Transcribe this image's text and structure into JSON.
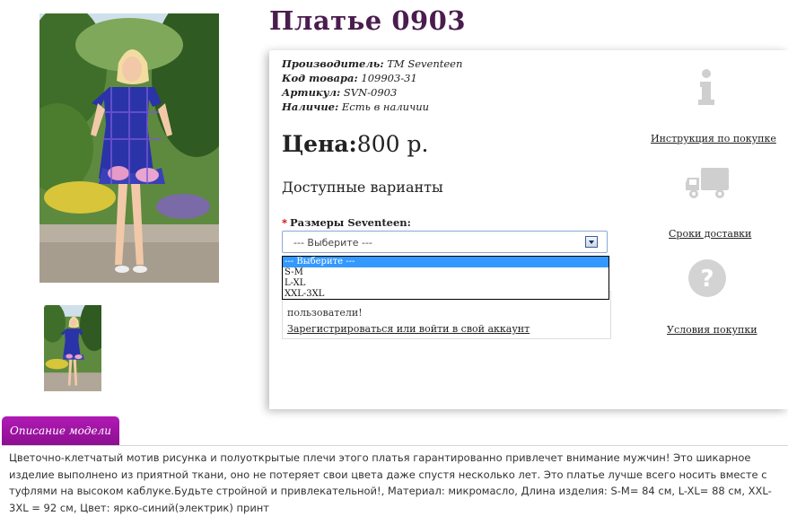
{
  "product": {
    "title": "Платье 0903",
    "meta": [
      {
        "label": "Производитель:",
        "value": "TM Seventeen"
      },
      {
        "label": "Код товара:",
        "value": "109903-31"
      },
      {
        "label": "Артикул:",
        "value": "SVN-0903"
      },
      {
        "label": "Наличие:",
        "value": "Есть в наличии"
      }
    ],
    "price_label": "Цена:",
    "price_value": "800 р."
  },
  "variants": {
    "heading": "Доступные варианты",
    "required_mark": "*",
    "size_label": "Размеры Seventeen:",
    "select_value": "--- Выберите ---",
    "options": [
      "--- Выберите ---",
      "S-M",
      "L-XL",
      "XXL-3XL"
    ],
    "highlighted_option": 0
  },
  "login_notice": {
    "text_visible": "пользователи!",
    "link": "Зарегистрироваться или войти в свой аккаунт"
  },
  "side_links": {
    "instruction": {
      "label": "Инструкция по покупке",
      "icon": "info-icon"
    },
    "delivery": {
      "label": "Сроки доставки",
      "icon": "truck-icon"
    },
    "conditions": {
      "label": "Условия покупки",
      "icon": "question-icon"
    }
  },
  "description": {
    "tab_label": "Описание модели",
    "text": "Цветочно-клетчатый мотив рисунка и полуоткрытые плечи этого платья гарантированно привлечет внимание мужчин! Это шикарное изделие выполнено из приятной ткани, оно не потеряет свои цвета даже спустя несколько лет. Это платье лучше всего носить вместе с туфлями на высоком каблуке.Будьте стройной и привлекательной!, Материал: микромасло, Длина изделия: S-M= 84 см, L-XL= 88 см, XXL-3XL = 92 см, Цвет: ярко-синий(электрик) принт"
  },
  "colors": {
    "title": "#4a1d4e",
    "tab": "#a015a5",
    "dropdown_highlight": "#3399ff",
    "icon_gray": "#d0d0d0"
  }
}
